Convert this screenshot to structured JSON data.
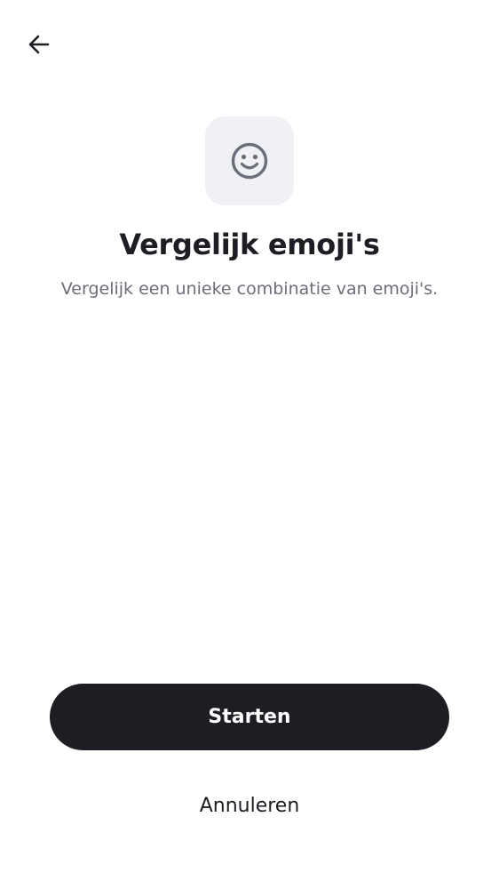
{
  "header": {
    "back_icon": "arrow-left-icon"
  },
  "hero": {
    "icon": "smiley-face-icon",
    "icon_color": "#6b6e78",
    "tile_color": "#f0f1f5",
    "title": "Vergelijk emoji's",
    "subtitle": "Vergelijk een unieke combinatie van emoji's."
  },
  "actions": {
    "start_label": "Starten",
    "cancel_label": "Annuleren",
    "primary_color": "#1d1e23"
  }
}
